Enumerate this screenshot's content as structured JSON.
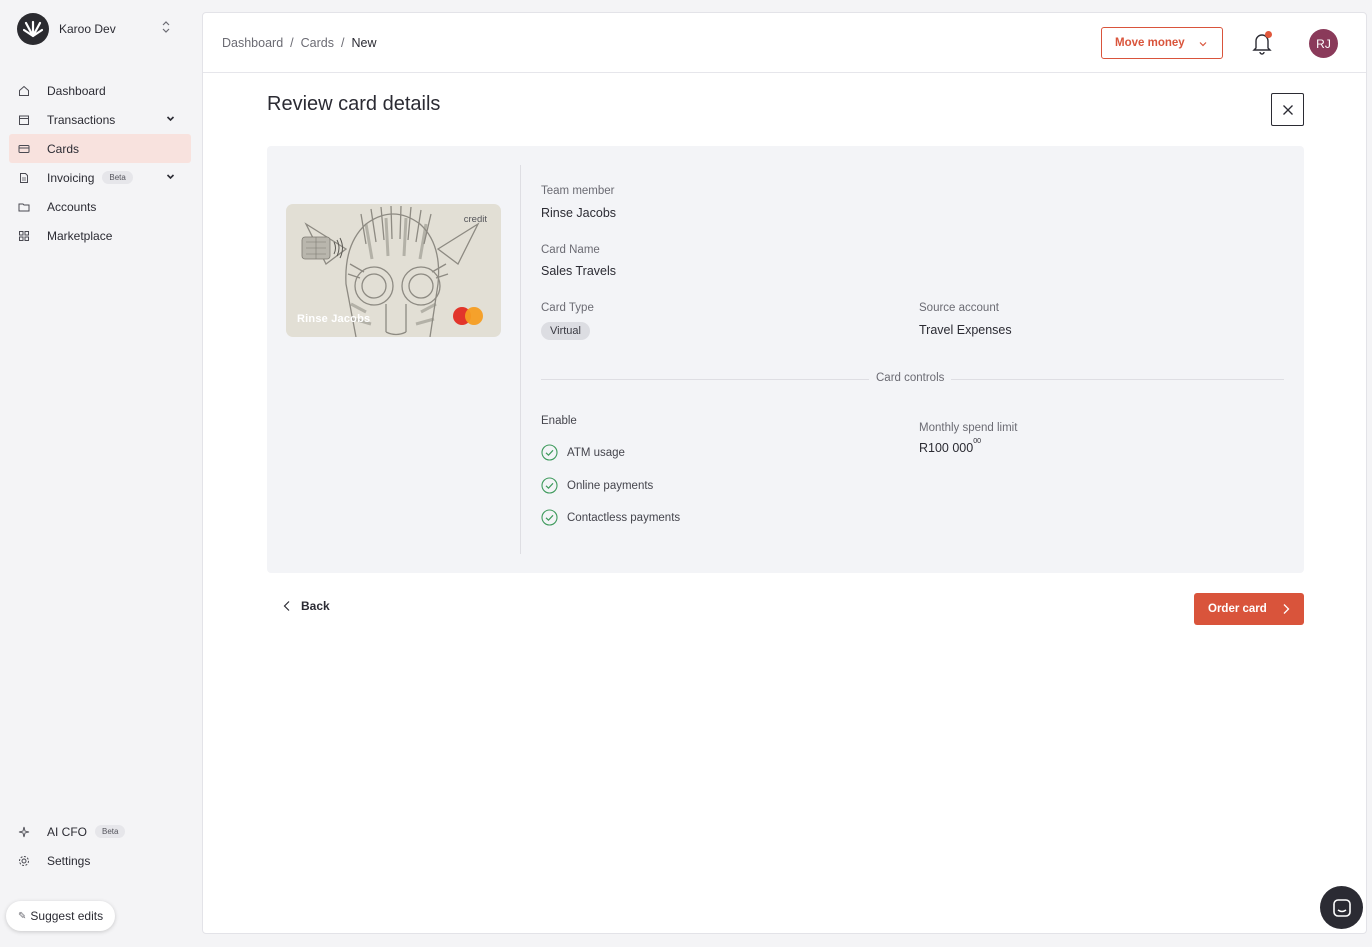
{
  "org": {
    "name": "Karoo Dev",
    "logo_icon": "karoo-logo"
  },
  "sidebar": {
    "items": [
      {
        "label": "Dashboard",
        "icon": "home-icon"
      },
      {
        "label": "Transactions",
        "icon": "calendar-icon",
        "expandable": true
      },
      {
        "label": "Cards",
        "icon": "card-icon",
        "active": true
      },
      {
        "label": "Invoicing",
        "icon": "document-icon",
        "badge": "Beta",
        "expandable": true
      },
      {
        "label": "Accounts",
        "icon": "folder-icon"
      },
      {
        "label": "Marketplace",
        "icon": "grid-icon"
      }
    ],
    "bottom_items": [
      {
        "label": "AI CFO",
        "icon": "sparkle-icon",
        "badge": "Beta"
      },
      {
        "label": "Settings",
        "icon": "gear-icon"
      }
    ],
    "suggest_edits": "Suggest edits"
  },
  "breadcrumb": {
    "items": [
      "Dashboard",
      "Cards"
    ],
    "current": "New",
    "separator": "/"
  },
  "header": {
    "move_money_label": "Move money",
    "avatar_initials": "RJ",
    "has_notification": true
  },
  "page": {
    "title": "Review card details"
  },
  "card_preview": {
    "type_label": "credit",
    "holder_name": "Rinse Jacobs",
    "network": "mastercard"
  },
  "details": {
    "team_member_label": "Team member",
    "team_member_value": "Rinse Jacobs",
    "card_name_label": "Card Name",
    "card_name_value": "Sales Travels",
    "card_type_label": "Card Type",
    "card_type_value": "Virtual",
    "source_account_label": "Source account",
    "source_account_value": "Travel Expenses"
  },
  "controls": {
    "section_label": "Card controls",
    "enable_label": "Enable",
    "enabled": [
      "ATM usage",
      "Online payments",
      "Contactless payments"
    ],
    "limit_label": "Monthly spend limit",
    "limit_value": "R100 000",
    "limit_cents": "00"
  },
  "actions": {
    "back_label": "Back",
    "order_label": "Order card"
  },
  "colors": {
    "accent": "#d9543b",
    "active_nav": "#f8e2de",
    "check": "#3e9a5c",
    "avatar": "#8a3a5a"
  }
}
